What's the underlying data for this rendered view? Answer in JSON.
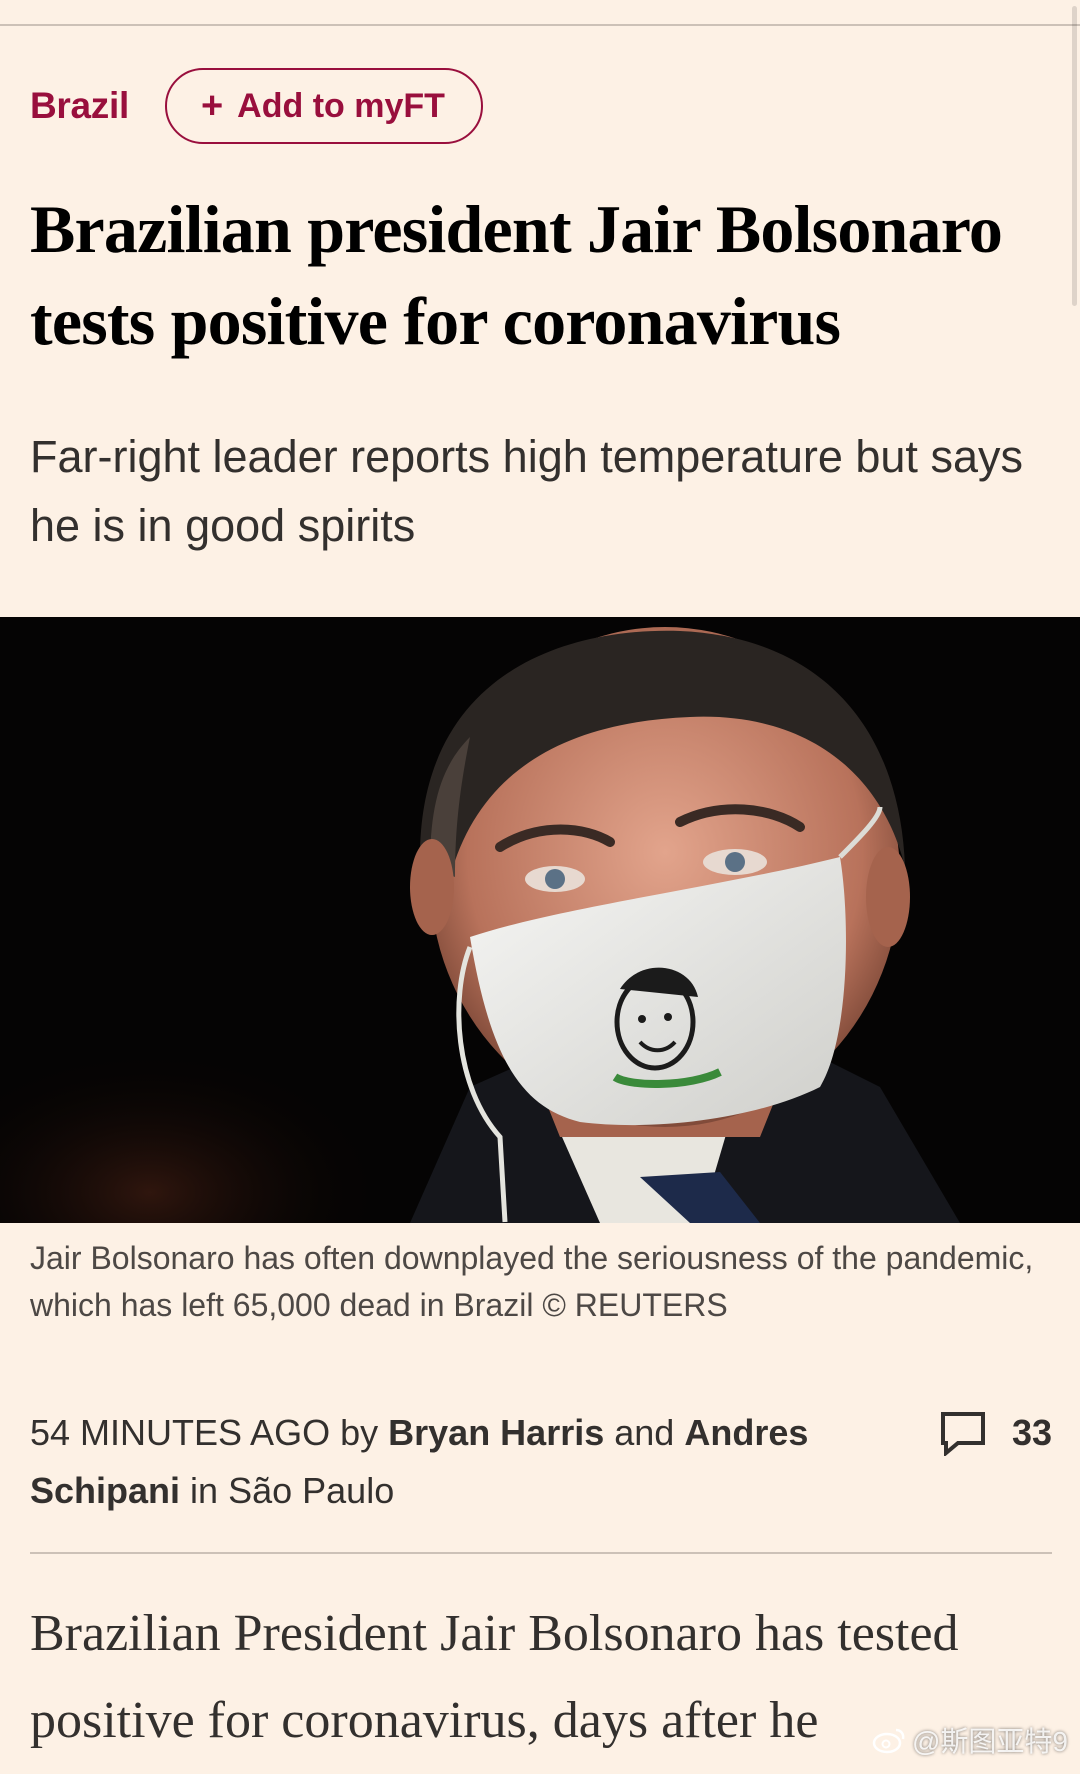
{
  "topic": {
    "label": "Brazil",
    "follow_button": "Add to myFT"
  },
  "article": {
    "headline": "Brazilian president Jair Bolsonaro tests positive for coronavirus",
    "standfirst": "Far-right leader reports high temperature but says he is in good spirits",
    "image_caption": "Jair Bolsonaro has often downplayed the seriousness of the pandemic, which has left 65,000 dead in Brazil © REUTERS",
    "byline": {
      "time": "54 MINUTES AGO",
      "by": "by",
      "author_1": "Bryan Harris",
      "and": "and",
      "author_2": "Andres Schipani",
      "location_prefix": "in",
      "location": "São Paulo"
    },
    "comment_count": "33",
    "body_first_para": "Brazilian President Jair Bolsonaro has tested positive for coronavirus, days after he"
  },
  "watermark": "@斯图亚特9",
  "colors": {
    "background": "#fdf1e5",
    "accent": "#990f3d",
    "text": "#33302e",
    "divider": "#ccc1b7"
  },
  "icons": {
    "follow": "plus-icon",
    "comments": "speech-bubble-icon",
    "watermark": "weibo-icon"
  }
}
